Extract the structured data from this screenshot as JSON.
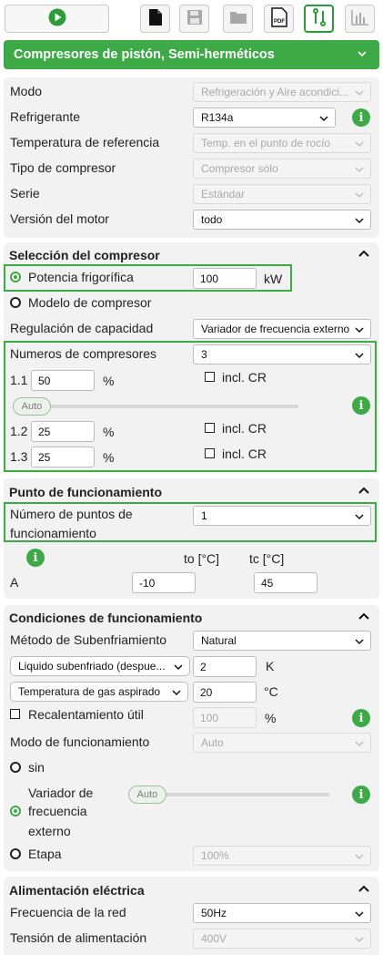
{
  "toolbar": {
    "play_icon": "play-icon",
    "buttons": [
      "new-document-icon",
      "save-icon",
      "open-folder-icon",
      "pdf-icon",
      "compare-icon",
      "chart-icon"
    ]
  },
  "header": {
    "title": "Compresores de pistón, Semi-herméticos"
  },
  "general": {
    "modo_label": "Modo",
    "modo_value": "Refrigeración y Aire acondici...",
    "refrigerante_label": "Refrigerante",
    "refrigerante_value": "R134a",
    "temp_ref_label": "Temperatura de referencia",
    "temp_ref_value": "Temp. en el punto de rocío",
    "tipo_label": "Tipo de compresor",
    "tipo_value": "Compresor sólo",
    "serie_label": "Serie",
    "serie_value": "Estándar",
    "version_label": "Versión del motor",
    "version_value": "todo"
  },
  "seleccion": {
    "title": "Selección del compresor",
    "potencia_label": "Potencia frigorífica",
    "potencia_value": "100",
    "potencia_unit": "kW",
    "modelo_label": "Modelo de compresor",
    "regulacion_label": "Regulación de capacidad",
    "regulacion_value": "Variador de frecuencia externo",
    "numeros_label": "Numeros de compresores",
    "numeros_value": "3",
    "compressors": [
      {
        "id": "1.1",
        "value": "50",
        "unit": "%",
        "cr_label": "incl. CR"
      },
      {
        "id": "1.2",
        "value": "25",
        "unit": "%",
        "cr_label": "incl. CR"
      },
      {
        "id": "1.3",
        "value": "25",
        "unit": "%",
        "cr_label": "incl. CR"
      }
    ],
    "slider_label": "Auto"
  },
  "punto": {
    "title": "Punto de funcionamiento",
    "numero_label_1": "Número de puntos de",
    "numero_label_2": "funcionamiento",
    "numero_value": "1",
    "to_header": "to [°C]",
    "tc_header": "tc [°C]",
    "row_label": "A",
    "to_value": "-10",
    "tc_value": "45"
  },
  "condiciones": {
    "title": "Condiciones de funcionamiento",
    "metodo_label": "Método de Subenfriamiento",
    "metodo_value": "Natural",
    "liquido_select": "Liquido subenfriado (despue...",
    "liquido_value": "2",
    "liquido_unit": "K",
    "gas_select": "Temperatura de gas aspirado",
    "gas_value": "20",
    "gas_unit": "°C",
    "recal_label": "Recalentamiento útil",
    "recal_value": "100",
    "recal_unit": "%",
    "modo_func_label": "Modo de funcionamiento",
    "modo_func_value": "Auto",
    "sin_label": "sin",
    "variador_label_1": "Variador de",
    "variador_label_2": "frecuencia",
    "variador_label_3": "externo",
    "slider_label": "Auto",
    "etapa_label": "Etapa",
    "etapa_value": "100%"
  },
  "alimentacion": {
    "title": "Alimentación eléctrica",
    "frecuencia_label": "Frecuencia de la red",
    "frecuencia_value": "50Hz",
    "tension_label": "Tensión de alimentación",
    "tension_value": "400V"
  },
  "colors": {
    "accent": "#3daa47",
    "panel": "#f2f2f2"
  }
}
